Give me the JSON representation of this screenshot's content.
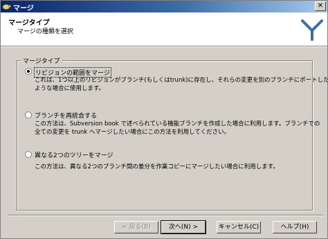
{
  "window": {
    "title": "マージ",
    "close_label": "✕"
  },
  "header": {
    "title": "マージタイプ",
    "subtitle": "マージの種類を選択"
  },
  "group": {
    "legend": "マージタイプ"
  },
  "options": [
    {
      "label": "リビジョンの範囲をマージ",
      "selected": true,
      "desc1": "これは、1つ以上のリビジョンがブランチ(もしくはtrunk)に存在し、それらの変更を別のブランチにポートしたい",
      "desc2": "ような場合に使用します。"
    },
    {
      "label": "ブランチを再統合する",
      "selected": false,
      "desc1": "この方法は、Subversion book で述べられている機能ブランチを作成した場合に利用します。ブランチでの",
      "desc2": "全ての変更を trunk へマージしたい場合にこの方法を利用してください。"
    },
    {
      "label": "異なる2つのツリーをマージ",
      "selected": false,
      "desc1": "この方法は、異なる2つのブランチ間の差分を作業コピーにマージしたい場合に利用します。",
      "desc2": ""
    }
  ],
  "buttons": {
    "back": "< 戻る(B)",
    "next": "次へ(N) >",
    "cancel": "キャンセル(C)",
    "help": "ヘルプ(H)"
  },
  "colors": {
    "titlebar_start": "#0a246a",
    "titlebar_end": "#a6caf0",
    "logo": "#3a6ea5"
  }
}
